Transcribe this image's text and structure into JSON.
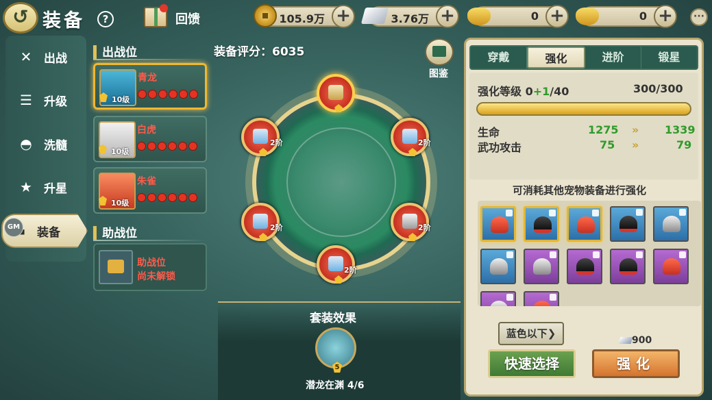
{
  "header": {
    "title": "装备",
    "help": "?",
    "feedback": "回馈",
    "resources": [
      {
        "icon": "copper-coin-icon",
        "value": "105.9万"
      },
      {
        "icon": "silver-bar-icon",
        "value": "3.76万"
      },
      {
        "icon": "gold-ingot-icon",
        "value": "0"
      },
      {
        "icon": "gold-yuanbao-icon",
        "value": "0"
      }
    ]
  },
  "sidebar": {
    "items": [
      {
        "icon": "crossed-swords-icon",
        "label": "出战"
      },
      {
        "icon": "scroll-icon",
        "label": "升级"
      },
      {
        "icon": "cauldron-icon",
        "label": "洗髓"
      },
      {
        "icon": "star-icon",
        "label": "升星"
      },
      {
        "icon": "anvil-icon",
        "label": "装备"
      }
    ],
    "gm": "GM"
  },
  "battle": {
    "title": "出战位",
    "score": "装备评分：6035",
    "pets": [
      {
        "name": "青龙",
        "level": "10级",
        "stars": 6
      },
      {
        "name": "白虎",
        "level": "10级",
        "stars": 6
      },
      {
        "name": "朱雀",
        "level": "10级",
        "stars": 6
      }
    ]
  },
  "assist": {
    "title": "助战位",
    "line1": "助战位",
    "line2": "尚未解锁"
  },
  "slots": [
    {
      "stage": "1",
      "label": ""
    },
    {
      "stage": "1",
      "label": "2阶"
    },
    {
      "stage": "1",
      "label": "2阶"
    },
    {
      "stage": "1",
      "label": "2阶"
    },
    {
      "stage": "1",
      "label": "2阶"
    },
    {
      "stage": "1",
      "label": "2阶"
    }
  ],
  "codex": "图鉴",
  "suit": {
    "title": "套装效果",
    "count": "5",
    "name": "潜龙在渊 4/6"
  },
  "panel": {
    "tabs": [
      "穿戴",
      "强化",
      "进阶",
      "锻星"
    ],
    "level_label": "强化等级 0",
    "level_plus": "+1",
    "level_max": "/40",
    "exp": "300/300",
    "exp_progress": 1.0,
    "stats": [
      {
        "name": "生命",
        "from": "1275",
        "to": "1339"
      },
      {
        "name": "武功攻击",
        "from": "75",
        "to": "79"
      }
    ],
    "consume_text": "可消耗其他宠物装备进行强化",
    "materials": [
      {
        "color": "blue",
        "kind": "red",
        "selected": true
      },
      {
        "color": "blue",
        "kind": "black",
        "selected": true
      },
      {
        "color": "blue",
        "kind": "red",
        "selected": true
      },
      {
        "color": "blue",
        "kind": "black",
        "selected": false
      },
      {
        "color": "blue",
        "kind": "silver",
        "selected": false
      },
      {
        "color": "blue",
        "kind": "silver",
        "selected": false
      },
      {
        "color": "purple",
        "kind": "silver",
        "selected": false
      },
      {
        "color": "purple",
        "kind": "black",
        "selected": false
      },
      {
        "color": "purple",
        "kind": "black",
        "selected": false
      },
      {
        "color": "purple",
        "kind": "red",
        "selected": false
      },
      {
        "color": "purple",
        "kind": "silver",
        "selected": false
      },
      {
        "color": "purple",
        "kind": "red",
        "selected": false
      }
    ],
    "filter": "蓝色以下",
    "cost": "900",
    "quick_select": "快速选择",
    "enhance": "强化"
  },
  "colors": {
    "accent": "#f0b730",
    "red_text": "#ff5a4a",
    "green_text": "#2f9b2b"
  }
}
